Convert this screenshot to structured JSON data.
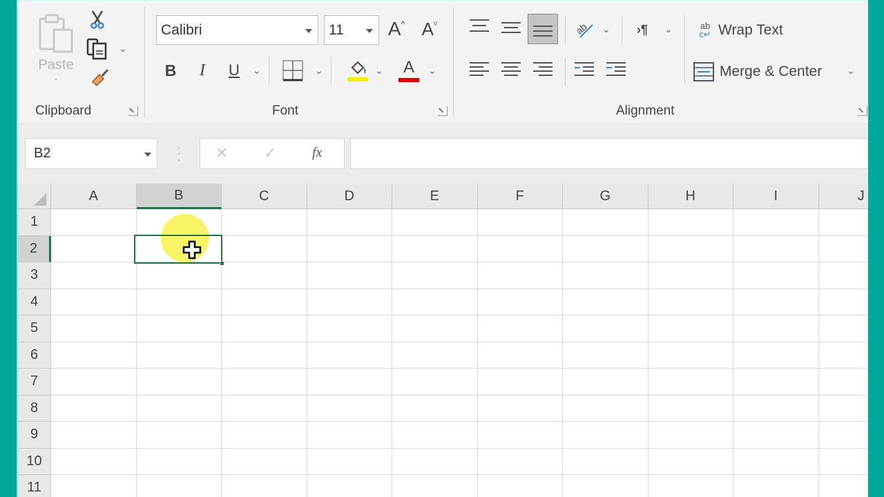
{
  "ribbon": {
    "clipboard": {
      "label": "Clipboard",
      "paste_label": "Paste"
    },
    "font": {
      "label": "Font",
      "font_name": "Calibri",
      "font_size": "11",
      "grow_glyph": "A",
      "shrink_glyph": "A",
      "bold": "B",
      "italic": "I",
      "underline": "U",
      "highlight_color": "#f0f000",
      "font_color": "#e00000"
    },
    "alignment": {
      "label": "Alignment",
      "wrap_text": "Wrap Text",
      "merge_center": "Merge & Center"
    }
  },
  "formula_bar": {
    "name_box": "B2",
    "cancel_glyph": "✕",
    "enter_glyph": "✓",
    "fx": "fx",
    "formula": ""
  },
  "sheet": {
    "columns": [
      "A",
      "B",
      "C",
      "D",
      "E",
      "F",
      "G",
      "H",
      "I",
      "J"
    ],
    "rows": [
      "1",
      "2",
      "3",
      "4",
      "5",
      "6",
      "7",
      "8",
      "9",
      "10",
      "11"
    ],
    "active_cell": "B2",
    "accent": "#217346"
  }
}
